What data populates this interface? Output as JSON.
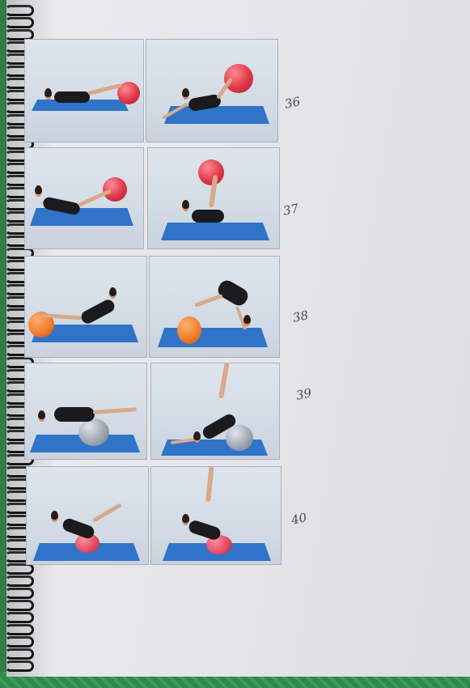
{
  "rows": [
    {
      "number": "36",
      "ball": "red",
      "photos": 2
    },
    {
      "number": "37",
      "ball": "red",
      "photos": 2
    },
    {
      "number": "38",
      "ball": "orange",
      "photos": 2
    },
    {
      "number": "39",
      "ball": "grey",
      "photos": 2
    },
    {
      "number": "40",
      "ball": "pink",
      "photos": 2
    }
  ],
  "colors": {
    "paper": "#e9e8ec",
    "mat": "#2f74c8",
    "table": "#2f7d4a"
  }
}
